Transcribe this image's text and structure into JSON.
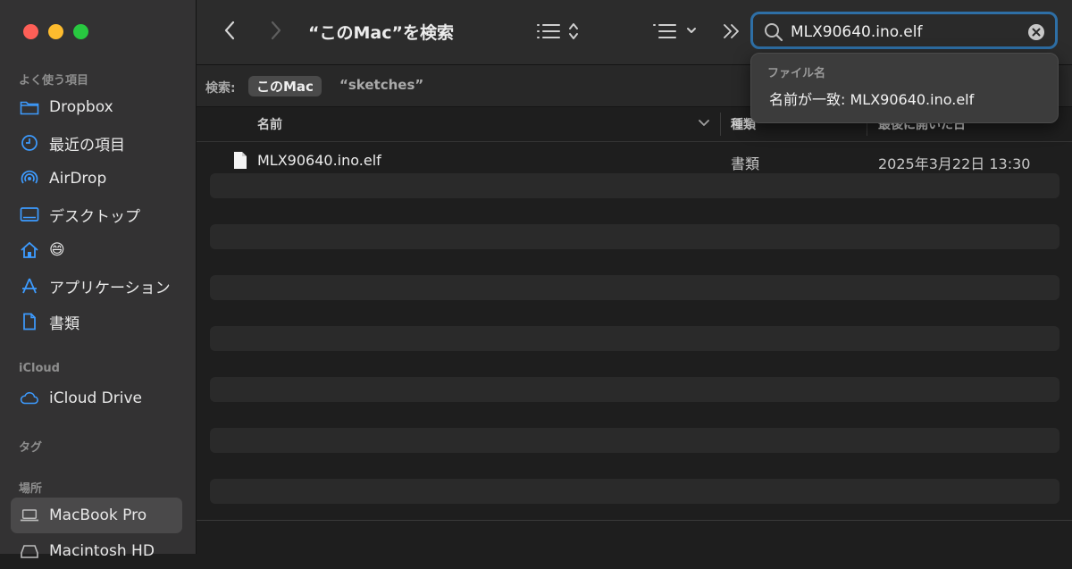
{
  "window": {
    "title": "“このMac”を検索"
  },
  "sidebar": {
    "favorites_header": "よく使う項目",
    "favorites": [
      {
        "label": "Dropbox",
        "icon": "folder-icon"
      },
      {
        "label": "最近の項目",
        "icon": "clock-icon"
      },
      {
        "label": "AirDrop",
        "icon": "airdrop-icon"
      },
      {
        "label": "デスクトップ",
        "icon": "desktop-icon"
      },
      {
        "label": "😄",
        "icon": "home-icon"
      },
      {
        "label": "アプリケーション",
        "icon": "applications-icon"
      },
      {
        "label": "書類",
        "icon": "document-icon"
      }
    ],
    "icloud_header": "iCloud",
    "icloud": [
      {
        "label": "iCloud Drive",
        "icon": "cloud-icon"
      }
    ],
    "tags_header": "タグ",
    "locations_header": "場所",
    "locations": [
      {
        "label": "MacBook Pro",
        "icon": "laptop-icon",
        "selected": true
      },
      {
        "label": "Macintosh HD",
        "icon": "disk-icon"
      }
    ]
  },
  "toolbar": {
    "search_value": "MLX90640.ino.elf"
  },
  "scope_bar": {
    "label": "検索:",
    "this_mac": "このMac",
    "sketches": "“sketches”"
  },
  "columns": {
    "name": "名前",
    "kind": "種類",
    "date": "最後に開いた日"
  },
  "results": [
    {
      "name": "MLX90640.ino.elf",
      "kind": "書類",
      "date": "2025年3月22日 13:30"
    }
  ],
  "search_suggestions": {
    "header": "ファイル名",
    "item": "名前が一致: MLX90640.ino.elf"
  },
  "colors": {
    "accent": "#2e6fa6",
    "sidebar_icon": "#3d9bff",
    "close": "#fe5f57",
    "minimize": "#febc2e",
    "zoom": "#28c840"
  }
}
